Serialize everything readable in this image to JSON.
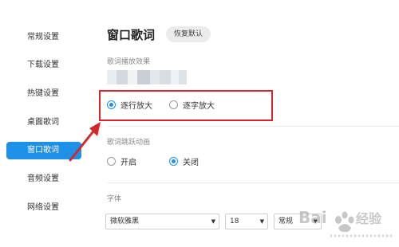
{
  "sidebar": {
    "items": [
      {
        "label": "常规设置",
        "active": false
      },
      {
        "label": "下载设置",
        "active": false
      },
      {
        "label": "热键设置",
        "active": false
      },
      {
        "label": "桌面歌词",
        "active": false
      },
      {
        "label": "窗口歌词",
        "active": true
      },
      {
        "label": "音频设置",
        "active": false
      },
      {
        "label": "网络设置",
        "active": false
      }
    ]
  },
  "main": {
    "title": "窗口歌词",
    "reset_label": "恢复默认",
    "playback_effect": {
      "label": "歌词播放效果",
      "options": [
        {
          "label": "逐行放大",
          "checked": true
        },
        {
          "label": "逐字放大",
          "checked": false
        }
      ]
    },
    "jump_animation": {
      "label": "歌词跳跃动画",
      "options": [
        {
          "label": "开启",
          "checked": false
        },
        {
          "label": "关闭",
          "checked": true
        }
      ]
    },
    "font": {
      "label": "字体",
      "family_value": "微软雅黑",
      "size_value": "18",
      "style_value": "常规"
    }
  },
  "colors": {
    "accent": "#1e90e8",
    "annotation_red": "#d6262c"
  }
}
